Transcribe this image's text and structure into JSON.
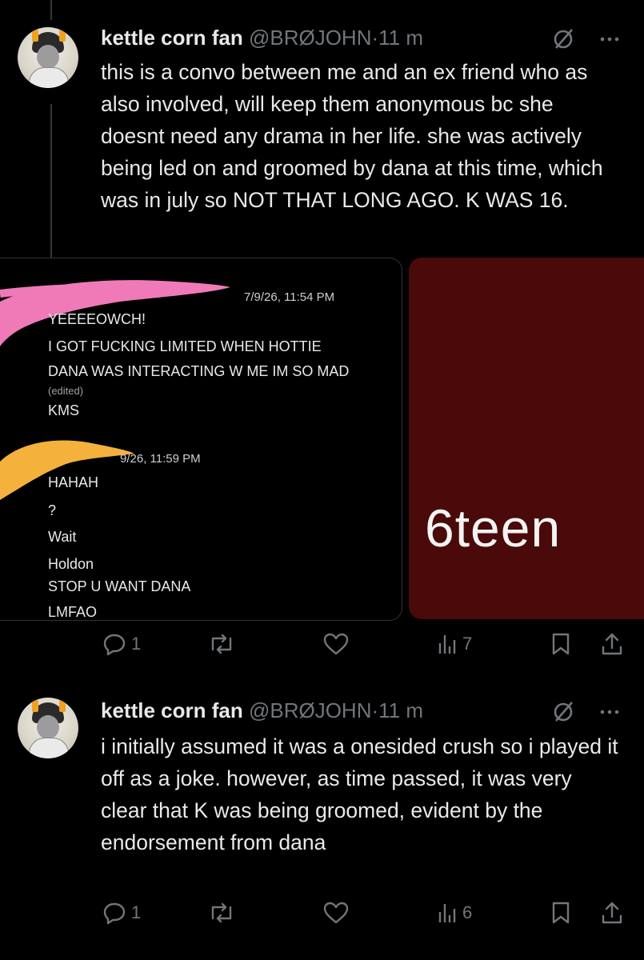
{
  "tweets": [
    {
      "display_name": "kettle corn fan",
      "handle": "@BRØJOHN",
      "separator": "·",
      "time": "11 m",
      "text": "this is a convo between me and an ex friend who as also involved, will keep them anonymous bc she doesnt need any drama in her life. she was actively being led on and groomed by dana at this time, which was in july so NOT THAT LONG AGO. K WAS 16.",
      "replies": "1",
      "reposts": "",
      "likes": "",
      "views": "7"
    },
    {
      "display_name": "kettle corn fan",
      "handle": "@BRØJOHN",
      "separator": "·",
      "time": "11 m",
      "text": "i initially assumed it was a onesided crush so i played it off as a joke. however, as time passed, it was very clear that K was being groomed, evident by the endorsement from dana",
      "replies": "1",
      "reposts": "",
      "likes": "",
      "views": "6"
    }
  ],
  "media": {
    "chat": {
      "msg1_time": "7/9/26, 11:54 PM",
      "msg1_lines": [
        "YEEEEOWCH!",
        "I GOT FUCKING LIMITED WHEN HOTTIE",
        "DANA WAS INTERACTING W ME IM SO MAD"
      ],
      "msg1_edited": "(edited)",
      "msg1_extra": "KMS",
      "msg2_time": "9/26, 11:59 PM",
      "msg2_lines": [
        "HAHAH",
        "?",
        "Wait",
        "Holdon",
        "STOP U WANT DANA",
        "LMFAO"
      ]
    },
    "image_text": "6teen"
  },
  "colors": {
    "background": "#000000",
    "text": "#e7e9ea",
    "muted": "#71767b",
    "scribble_pink": "#f07ab8",
    "scribble_yellow": "#f4b23c",
    "right_image_bg": "#4a0a0a"
  },
  "icons": [
    "reply-icon",
    "repost-icon",
    "like-icon",
    "views-icon",
    "bookmark-icon",
    "share-icon",
    "grok-icon",
    "more-icon"
  ]
}
